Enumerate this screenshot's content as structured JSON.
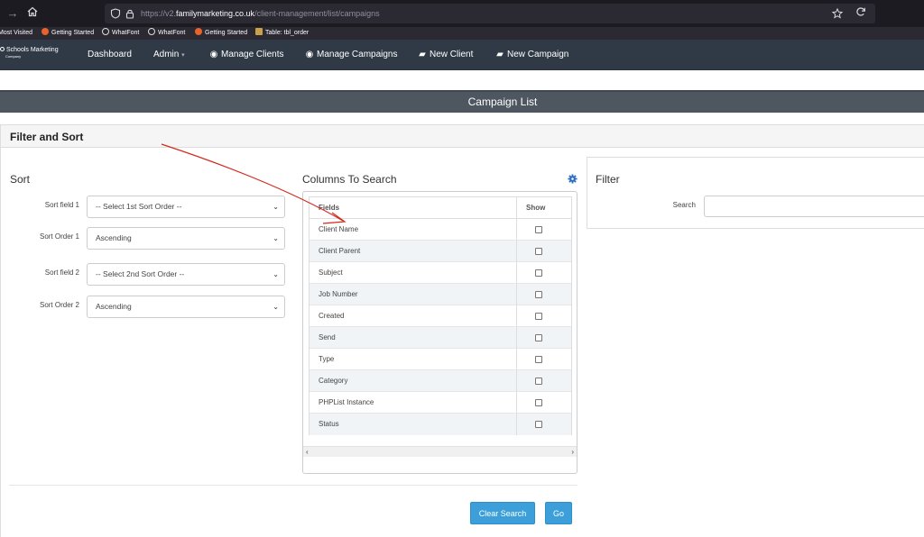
{
  "browser": {
    "url_prefix": "https://v2.",
    "url_domain": "familymarketing.co.uk",
    "url_path": "/client-management/list/campaigns",
    "bookmarks": [
      "Most Visited",
      "Getting Started",
      "WhatFont",
      "WhatFont",
      "Getting Started",
      "Table: tbl_order"
    ]
  },
  "brand": {
    "name": "Schools Marketing",
    "sub": "Company"
  },
  "nav": {
    "dashboard": "Dashboard",
    "admin": "Admin",
    "manage_clients": "Manage Clients",
    "manage_campaigns": "Manage Campaigns",
    "new_client": "New Client",
    "new_campaign": "New Campaign"
  },
  "page_title": "Campaign List",
  "panel_title": "Filter and Sort",
  "sort": {
    "title": "Sort",
    "field1_label": "Sort field 1",
    "field1_value": "-- Select 1st Sort Order --",
    "order1_label": "Sort Order 1",
    "order1_value": "Ascending",
    "field2_label": "Sort field 2",
    "field2_value": "-- Select 2nd Sort Order --",
    "order2_label": "Sort Order 2",
    "order2_value": "Ascending"
  },
  "columns": {
    "title": "Columns To Search",
    "header_fields": "Fields",
    "header_show": "Show",
    "rows": [
      "Client Name",
      "Client Parent",
      "Subject",
      "Job Number",
      "Created",
      "Send",
      "Type",
      "Category",
      "PHPList Instance",
      "Status"
    ]
  },
  "filter": {
    "title": "Filter",
    "search_label": "Search"
  },
  "buttons": {
    "clear": "Clear Search",
    "go": "Go"
  },
  "colors": {
    "navbar": "#303a47",
    "header_bar": "#4e5760",
    "button": "#3c9fda",
    "annotation_arrow": "#d42a1e"
  }
}
